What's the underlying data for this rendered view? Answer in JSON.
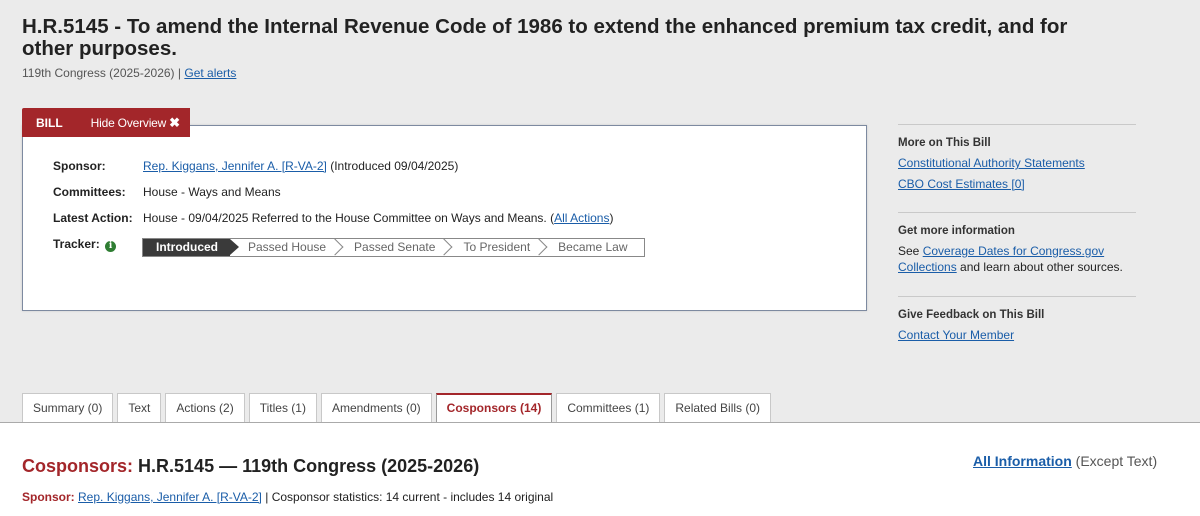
{
  "page": {
    "title": "H.R.5145 - To amend the Internal Revenue Code of 1986 to extend the enhanced premium tax credit, and for other purposes.",
    "congress": "119th Congress (2025-2026)",
    "separator": "|",
    "get_alerts": "Get alerts"
  },
  "overview_tab": {
    "bill_label": "BILL",
    "hide_label": "Hide Overview",
    "hide_icon": "close-x-icon",
    "hide_glyph": "✖"
  },
  "overview": {
    "sponsor_label": "Sponsor:",
    "sponsor_name": "Rep. Kiggans, Jennifer A. [R-VA-2]",
    "sponsor_introduced": "(Introduced 09/04/2025)",
    "committees_label": "Committees:",
    "committees_value": "House - Ways and Means",
    "latest_action_label": "Latest Action:",
    "latest_action_value": "House - 09/04/2025 Referred to the House Committee on Ways and Means.",
    "all_actions_open": "(",
    "all_actions_link": "All Actions",
    "all_actions_close": ")",
    "tracker_label": "Tracker:",
    "tracker_icon": "info-icon",
    "tracker_icon_glyph": "i",
    "tracker_steps": [
      "Introduced",
      "Passed House",
      "Passed Senate",
      "To President",
      "Became Law"
    ],
    "tracker_active_index": 0
  },
  "sidebar": {
    "more_heading": "More on This Bill",
    "more_links": [
      "Constitutional Authority Statements",
      "CBO Cost Estimates [0]"
    ],
    "info_heading": "Get more information",
    "info_prefix": "See",
    "info_link": "Coverage Dates for Congress.gov Collections",
    "info_suffix": "and learn about other sources.",
    "feedback_heading": "Give Feedback on This Bill",
    "feedback_link": "Contact Your Member"
  },
  "tabs": [
    {
      "label": "Summary (0)",
      "active": false
    },
    {
      "label": "Text",
      "active": false
    },
    {
      "label": "Actions (2)",
      "active": false
    },
    {
      "label": "Titles (1)",
      "active": false
    },
    {
      "label": "Amendments (0)",
      "active": false
    },
    {
      "label": "Cosponsors (14)",
      "active": true
    },
    {
      "label": "Committees (1)",
      "active": false
    },
    {
      "label": "Related Bills (0)",
      "active": false
    }
  ],
  "content": {
    "heading_prefix": "Cosponsors:",
    "heading_rest": "H.R.5145 — 119th Congress (2025-2026)",
    "all_info_link": "All Information",
    "all_info_suffix": "(Except Text)",
    "sponsor_label": "Sponsor:",
    "sponsor_link": "Rep. Kiggans, Jennifer A. [R-VA-2]",
    "sponsor_sep": "|",
    "stats": "Cosponsor statistics: 14 current - includes 14 original"
  },
  "colors": {
    "accent_red": "#a3262a",
    "link_blue": "#1a5da8",
    "tracker_active": "#3a3a3a",
    "info_green": "#2e7d32"
  }
}
